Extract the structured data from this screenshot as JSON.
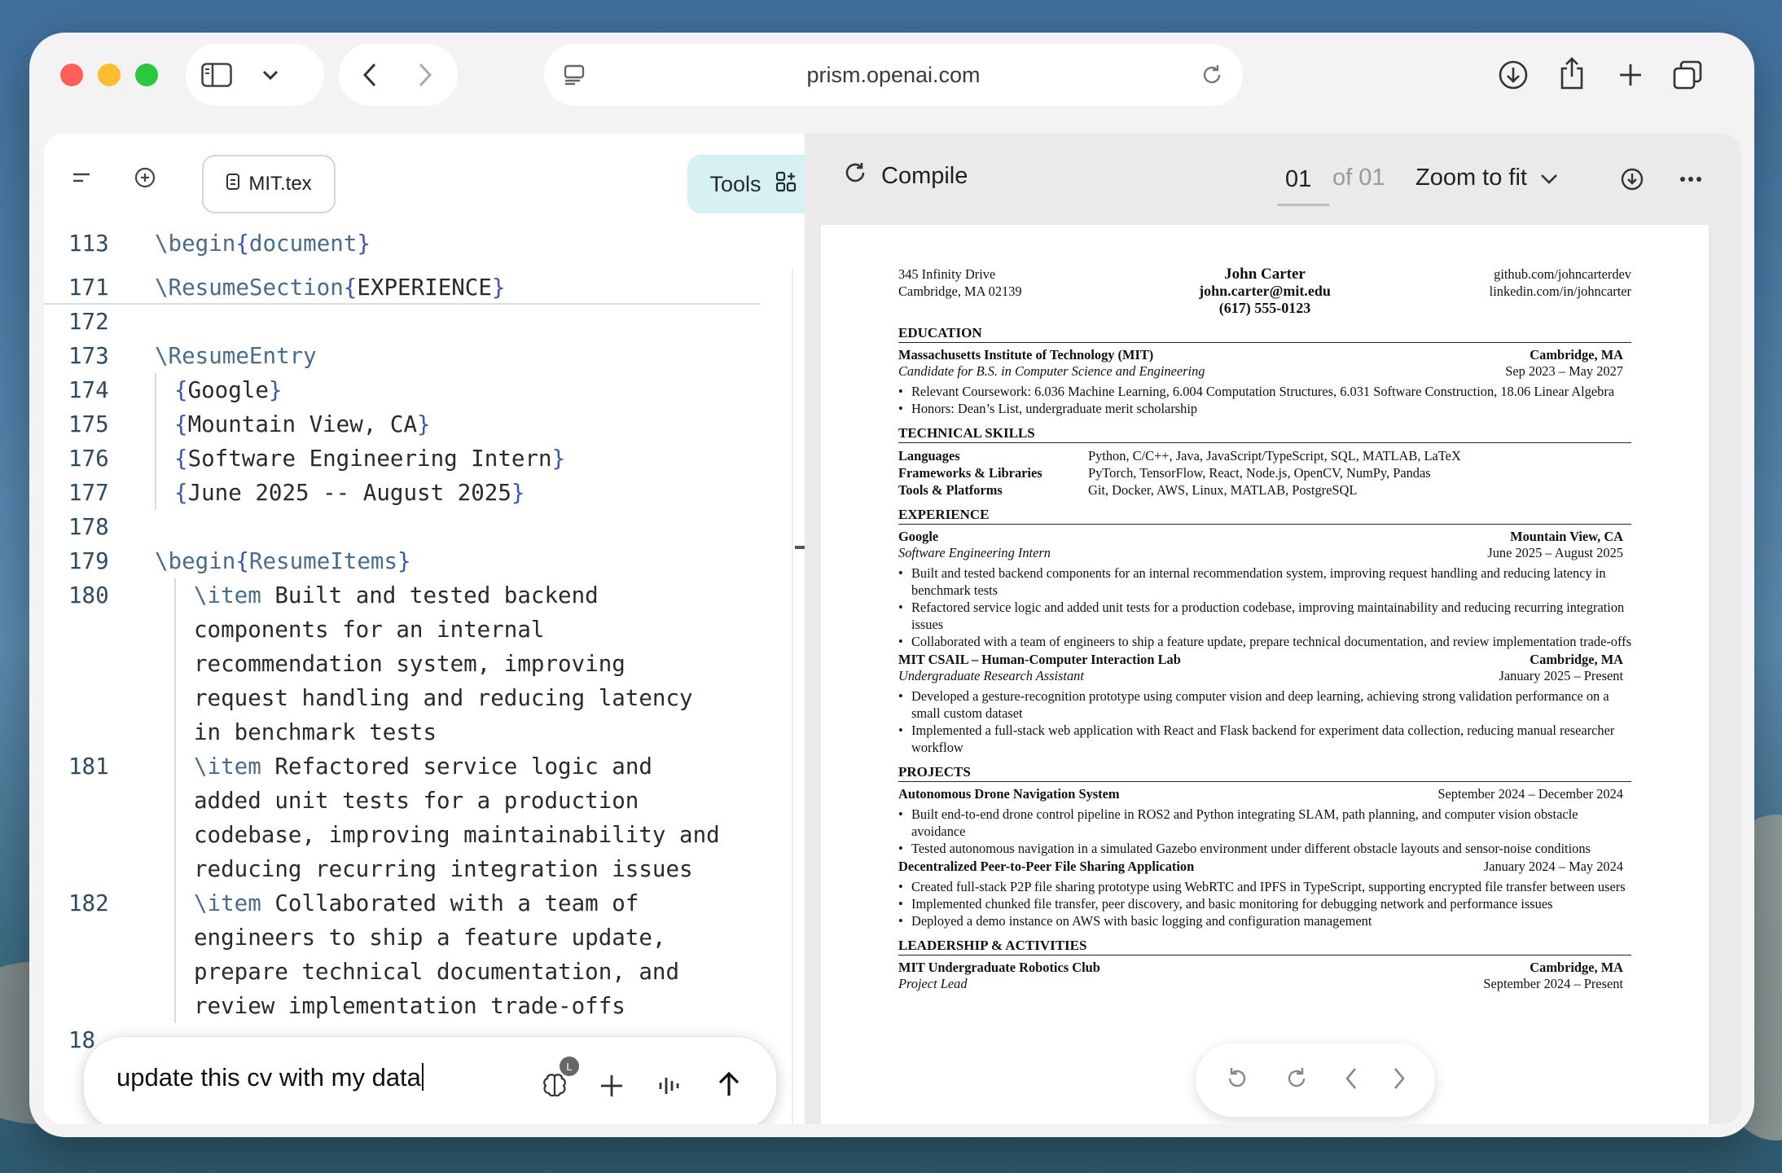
{
  "browser": {
    "url": "prism.openai.com"
  },
  "editor": {
    "file_tab": "MIT.tex",
    "tools_label": "Tools",
    "lines": [
      {
        "n": "113",
        "segments": [
          [
            "kw",
            "\\begin"
          ],
          [
            "br",
            "{"
          ],
          [
            "kw",
            "document"
          ],
          [
            "br",
            "}"
          ]
        ],
        "indent": 0
      },
      {
        "n": "171",
        "segments": [
          [
            "kw",
            "\\ResumeSection"
          ],
          [
            "br",
            "{"
          ],
          [
            "t",
            "EXPERIENCE"
          ],
          [
            "br",
            "}"
          ]
        ],
        "indent": 0
      },
      {
        "n": "172",
        "segments": [],
        "indent": 0
      },
      {
        "n": "173",
        "segments": [
          [
            "kw",
            "\\ResumeEntry"
          ]
        ],
        "indent": 0
      },
      {
        "n": "174",
        "segments": [
          [
            "br",
            "{"
          ],
          [
            "t",
            "Google"
          ],
          [
            "br",
            "}"
          ]
        ],
        "indent": 1
      },
      {
        "n": "175",
        "segments": [
          [
            "br",
            "{"
          ],
          [
            "t",
            "Mountain View, CA"
          ],
          [
            "br",
            "}"
          ]
        ],
        "indent": 1
      },
      {
        "n": "176",
        "segments": [
          [
            "br",
            "{"
          ],
          [
            "t",
            "Software Engineering Intern"
          ],
          [
            "br",
            "}"
          ]
        ],
        "indent": 1
      },
      {
        "n": "177",
        "segments": [
          [
            "br",
            "{"
          ],
          [
            "t",
            "June 2025 -- August 2025"
          ],
          [
            "br",
            "}"
          ]
        ],
        "indent": 1
      },
      {
        "n": "178",
        "segments": [],
        "indent": 0
      },
      {
        "n": "179",
        "segments": [
          [
            "kw",
            "\\begin"
          ],
          [
            "br",
            "{"
          ],
          [
            "kw",
            "ResumeItems"
          ],
          [
            "br",
            "}"
          ]
        ],
        "indent": 0
      },
      {
        "n": "180",
        "segments": [
          [
            "kw",
            "\\item"
          ],
          [
            "t",
            " Built and tested backend"
          ]
        ],
        "indent": 2
      },
      {
        "n": "",
        "segments": [
          [
            "t",
            "components for an internal"
          ]
        ],
        "indent": 2
      },
      {
        "n": "",
        "segments": [
          [
            "t",
            "recommendation system, improving"
          ]
        ],
        "indent": 2
      },
      {
        "n": "",
        "segments": [
          [
            "t",
            "request handling and reducing latency"
          ]
        ],
        "indent": 2
      },
      {
        "n": "",
        "segments": [
          [
            "t",
            "in benchmark tests"
          ]
        ],
        "indent": 2
      },
      {
        "n": "181",
        "segments": [
          [
            "kw",
            "\\item"
          ],
          [
            "t",
            " Refactored service logic and"
          ]
        ],
        "indent": 2
      },
      {
        "n": "",
        "segments": [
          [
            "t",
            "added unit tests for a production"
          ]
        ],
        "indent": 2
      },
      {
        "n": "",
        "segments": [
          [
            "t",
            "codebase, improving maintainability and"
          ]
        ],
        "indent": 2
      },
      {
        "n": "",
        "segments": [
          [
            "t",
            "reducing recurring integration issues"
          ]
        ],
        "indent": 2
      },
      {
        "n": "182",
        "segments": [
          [
            "kw",
            "\\item"
          ],
          [
            "t",
            " Collaborated with a team of"
          ]
        ],
        "indent": 2
      },
      {
        "n": "",
        "segments": [
          [
            "t",
            "engineers to ship a feature update,"
          ]
        ],
        "indent": 2
      },
      {
        "n": "",
        "segments": [
          [
            "t",
            "prepare technical documentation, and"
          ]
        ],
        "indent": 2
      },
      {
        "n": "",
        "segments": [
          [
            "t",
            "review implementation trade-offs"
          ]
        ],
        "indent": 2
      },
      {
        "n": "18",
        "segments": [],
        "indent": 0
      }
    ],
    "chat_input_value": "update this cv with my data",
    "model_badge": "L"
  },
  "preview": {
    "compile_label": "Compile",
    "page_current": "01",
    "page_of": "of 01",
    "zoom_label": "Zoom to fit",
    "resume": {
      "address_1": "345 Infinity Drive",
      "address_2": "Cambridge, MA 02139",
      "name": "John Carter",
      "email": "john.carter@mit.edu",
      "phone": "(617) 555-0123",
      "github": "github.com/johncarterdev",
      "linkedin": "linkedin.com/in/johncarter",
      "education_title": "EDUCATION",
      "edu_school": "Massachusetts Institute of Technology (MIT)",
      "edu_location": "Cambridge, MA",
      "edu_degree": "Candidate for B.S. in Computer Science and Engineering",
      "edu_dates": "Sep 2023 – May 2027",
      "edu_bullets": [
        "Relevant Coursework: 6.036 Machine Learning, 6.004 Computation Structures, 6.031 Software Construction, 18.06 Linear Algebra",
        "Honors: Dean’s List, undergraduate merit scholarship"
      ],
      "skills_title": "TECHNICAL SKILLS",
      "skills": [
        {
          "k": "Languages",
          "v": "Python, C/C++, Java, JavaScript/TypeScript, SQL, MATLAB, LaTeX"
        },
        {
          "k": "Frameworks & Libraries",
          "v": "PyTorch, TensorFlow, React, Node.js, OpenCV, NumPy, Pandas"
        },
        {
          "k": "Tools & Platforms",
          "v": "Git, Docker, AWS, Linux, MATLAB, PostgreSQL"
        }
      ],
      "experience_title": "EXPERIENCE",
      "exp1_org": "Google",
      "exp1_loc": "Mountain View, CA",
      "exp1_role": "Software Engineering Intern",
      "exp1_dates": "June 2025 – August 2025",
      "exp1_bullets": [
        "Built and tested backend components for an internal recommendation system, improving request handling and reducing latency in benchmark tests",
        "Refactored service logic and added unit tests for a production codebase, improving maintainability and reducing recurring integration issues",
        "Collaborated with a team of engineers to ship a feature update, prepare technical documentation, and review implementation trade-offs"
      ],
      "exp2_org": "MIT CSAIL – Human-Computer Interaction Lab",
      "exp2_loc": "Cambridge, MA",
      "exp2_role": "Undergraduate Research Assistant",
      "exp2_dates": "January 2025 – Present",
      "exp2_bullets": [
        "Developed a gesture-recognition prototype using computer vision and deep learning, achieving strong validation performance on a small custom dataset",
        "Implemented a full-stack web application with React and Flask backend for experiment data collection, reducing manual researcher workflow"
      ],
      "projects_title": "PROJECTS",
      "proj1_name": "Autonomous Drone Navigation System",
      "proj1_dates": "September 2024 – December 2024",
      "proj1_bullets": [
        "Built end-to-end drone control pipeline in ROS2 and Python integrating SLAM, path planning, and computer vision obstacle avoidance",
        "Tested autonomous navigation in a simulated Gazebo environment under different obstacle layouts and sensor-noise conditions"
      ],
      "proj2_name": "Decentralized Peer-to-Peer File Sharing Application",
      "proj2_dates": "January 2024 – May 2024",
      "proj2_bullets": [
        "Created full-stack P2P file sharing prototype using WebRTC and IPFS in TypeScript, supporting encrypted file transfer between users",
        "Implemented chunked file transfer, peer discovery, and basic monitoring for debugging network and performance issues",
        "Deployed a demo instance on AWS with basic logging and configuration management"
      ],
      "leadership_title": "LEADERSHIP & ACTIVITIES",
      "lead1_org": "MIT Undergraduate Robotics Club",
      "lead1_loc": "Cambridge, MA",
      "lead1_role": "Project Lead",
      "lead1_dates": "September 2024 – Present"
    }
  },
  "colors": {
    "tools_bg": "#d6f0f3",
    "close": "#ff5f57",
    "minimize": "#febc2e",
    "zoom": "#28c840"
  }
}
